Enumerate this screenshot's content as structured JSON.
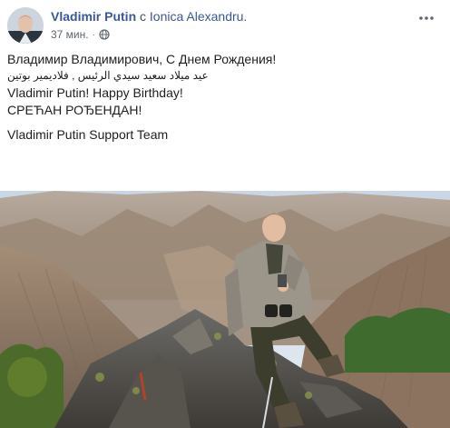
{
  "post": {
    "author": "Vladimir Putin",
    "with_prefix": "с",
    "tagged": "Ionica Alexandru.",
    "time": "37 мин.",
    "privacy_icon": "globe-icon",
    "more_icon": "more-options-icon",
    "lines": [
      "Владимир Владимирович, С Днем Рождения!",
      "عيد ميلاد سعيد سيدي الرئيس , فلاديمير بوتين",
      "Vladimir Putin! Happy Birthday!",
      "СРЕЋАН РОЂЕНДАН!",
      "Vladimir Putin Support Team"
    ],
    "colors": {
      "link": "#385898",
      "meta": "#616770"
    }
  }
}
